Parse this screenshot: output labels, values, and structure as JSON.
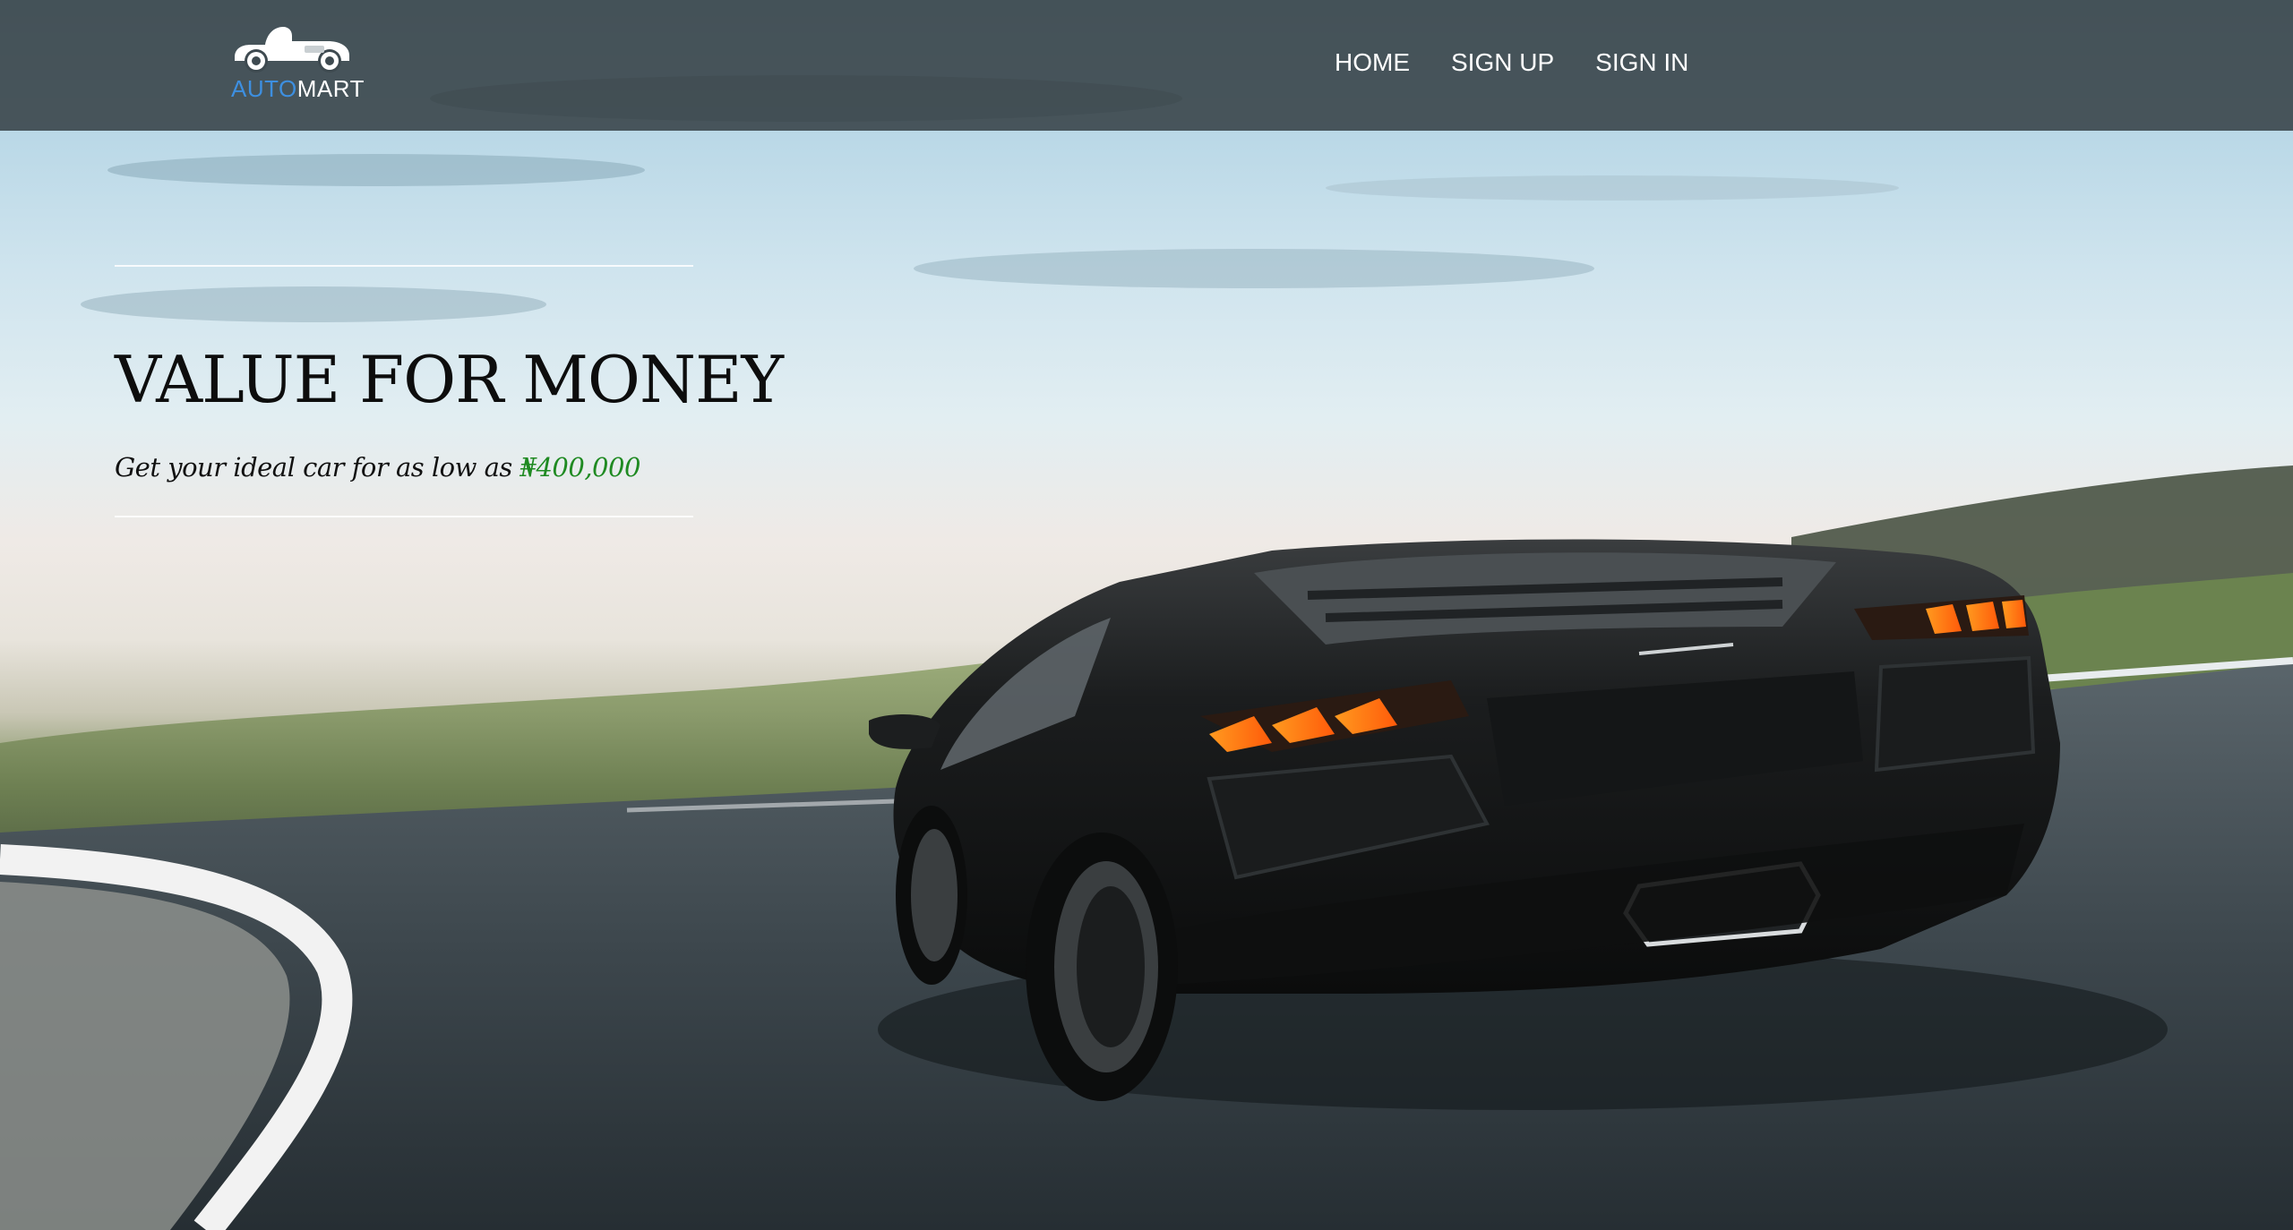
{
  "brand": {
    "logo_part1": "AUTO",
    "logo_part2": "MART",
    "icon": "vintage-car-icon",
    "accent_color": "#3d8fe0"
  },
  "nav": {
    "items": [
      {
        "label": "HOME"
      },
      {
        "label": "SIGN UP"
      },
      {
        "label": "SIGN IN"
      }
    ]
  },
  "hero": {
    "headline": "VALUE FOR MONEY",
    "tagline_prefix": "Get your ideal car for as low as ",
    "price": "₦400,000",
    "price_color": "#1f8a22",
    "background_image": "black-sports-car-on-road"
  }
}
